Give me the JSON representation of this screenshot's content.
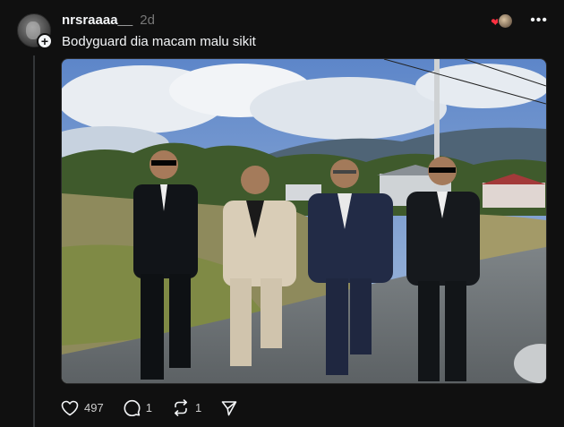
{
  "post": {
    "username": "nrsraaaa__",
    "time": "2d",
    "text": "Bodyguard dia macam malu sikit"
  },
  "image": {
    "description_icon": "photo-of-four-men-in-suits-walking"
  },
  "actions": {
    "likes": "497",
    "replies": "1",
    "reposts": "1"
  },
  "icons": {
    "follow": "plus-icon",
    "reaction": "heart-icon",
    "more": "more-icon",
    "like": "heart-outline-icon",
    "reply": "comment-icon",
    "repost": "repost-icon",
    "share": "send-icon"
  },
  "colors": {
    "background": "#101010",
    "text": "#f3f5f7",
    "muted": "#777777",
    "heart": "#ff3040"
  }
}
